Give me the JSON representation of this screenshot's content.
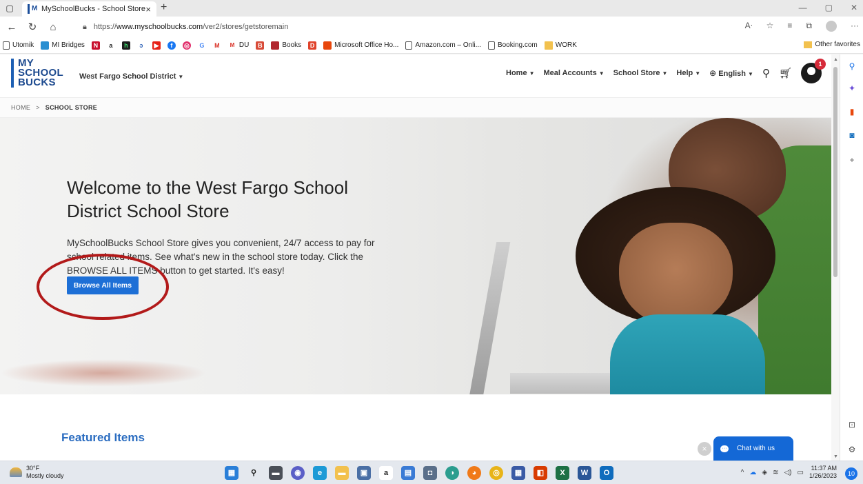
{
  "browser": {
    "tab_title": "MySchoolBucks - School Store",
    "tab_favicon": "M",
    "url_prefix": "https://",
    "url_domain": "www.myschoolbucks.com",
    "url_path": "/ver2/stores/getstoremain",
    "bookmarks": [
      {
        "label": "Utomik",
        "icon": "doc-icon"
      },
      {
        "label": "MI Bridges",
        "icon": "mi-bridges-icon"
      }
    ],
    "bookmarks_mid": [
      {
        "label": "Books",
        "icon": "books-icon"
      },
      {
        "label": "Microsoft Office Ho...",
        "icon": "office-icon"
      },
      {
        "label": "Amazon.com – Onli...",
        "icon": "doc-icon"
      },
      {
        "label": "Booking.com",
        "icon": "doc-icon"
      },
      {
        "label": "WORK",
        "icon": "folder-icon"
      }
    ],
    "bookmark_du": "DU",
    "other_favorites": "Other favorites"
  },
  "site": {
    "logo_lines": [
      "MY",
      "SCHOOL",
      "BUCKS"
    ],
    "district": "West Fargo School District",
    "nav": {
      "home": "Home",
      "meal_accounts": "Meal Accounts",
      "school_store": "School Store",
      "help": "Help",
      "language": "English"
    },
    "notification_count": "1",
    "breadcrumb": {
      "home": "HOME",
      "sep": ">",
      "current": "SCHOOL STORE"
    },
    "hero": {
      "title": "Welcome to the West Fargo School District School Store",
      "description": "MySchoolBucks School Store gives you convenient, 24/7 access to pay for school related items. See what's new in the school store today. Click the BROWSE ALL ITEMS button to get started. It's easy!",
      "button_label": "Browse All Items"
    },
    "featured_heading": "Featured Items",
    "chat_label": "Chat with us"
  },
  "taskbar": {
    "temperature": "30°F",
    "conditions": "Mostly cloudy",
    "time": "11:37 AM",
    "date": "1/26/2023",
    "notifications": "10"
  },
  "colors": {
    "brand_blue": "#1d6fd6",
    "logo_blue": "#1d4a8f",
    "annotation_red": "#b21a1a",
    "featured_blue": "#2a6cc0"
  }
}
